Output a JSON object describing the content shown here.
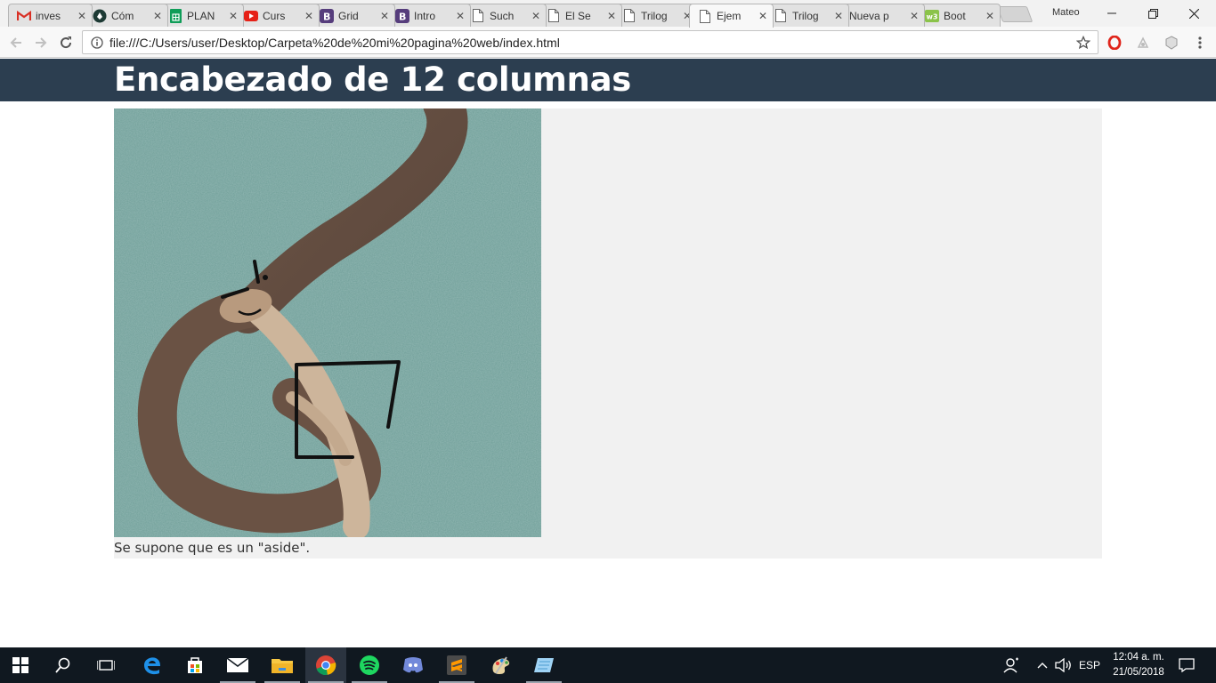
{
  "browser": {
    "tabs": [
      {
        "label": "inves",
        "icon": "gmail-icon"
      },
      {
        "label": "Cóm",
        "icon": "site-icon"
      },
      {
        "label": "PLAN",
        "icon": "sheets-icon"
      },
      {
        "label": "Curs",
        "icon": "youtube-icon"
      },
      {
        "label": "Grid",
        "icon": "bootstrap-icon"
      },
      {
        "label": "Intro",
        "icon": "bootstrap-icon"
      },
      {
        "label": "Such",
        "icon": "document-icon"
      },
      {
        "label": "El Se",
        "icon": "document-icon"
      },
      {
        "label": "Trilog",
        "icon": "document-icon"
      },
      {
        "label": "Ejem",
        "icon": "document-icon",
        "active": true
      },
      {
        "label": "Trilog",
        "icon": "document-icon"
      },
      {
        "label": "Nueva p",
        "icon": "none"
      },
      {
        "label": "Boot",
        "icon": "w3schools-icon"
      }
    ],
    "tab_close_glyph": "✕",
    "profile_name": "Mateo",
    "url": "file:///C:/Users/user/Desktop/Carpeta%20de%20mi%20pagina%20web/index.html"
  },
  "page": {
    "header_title": "Encabezado de 12 columnas",
    "aside_caption": "Se supone que es un \"aside\".",
    "colors": {
      "header_bg": "#2c3e50",
      "aside_bg": "#f1f1f1"
    }
  },
  "taskbar": {
    "language": "ESP",
    "time": "12:04 a. m.",
    "date": "21/05/2018",
    "apps": [
      "start-icon",
      "search-icon",
      "task-view-icon",
      "edge-icon",
      "store-icon",
      "mail-icon",
      "file-explorer-icon",
      "chrome-icon",
      "spotify-icon",
      "discord-icon",
      "sublime-icon",
      "paint-icon",
      "notes-icon"
    ]
  }
}
